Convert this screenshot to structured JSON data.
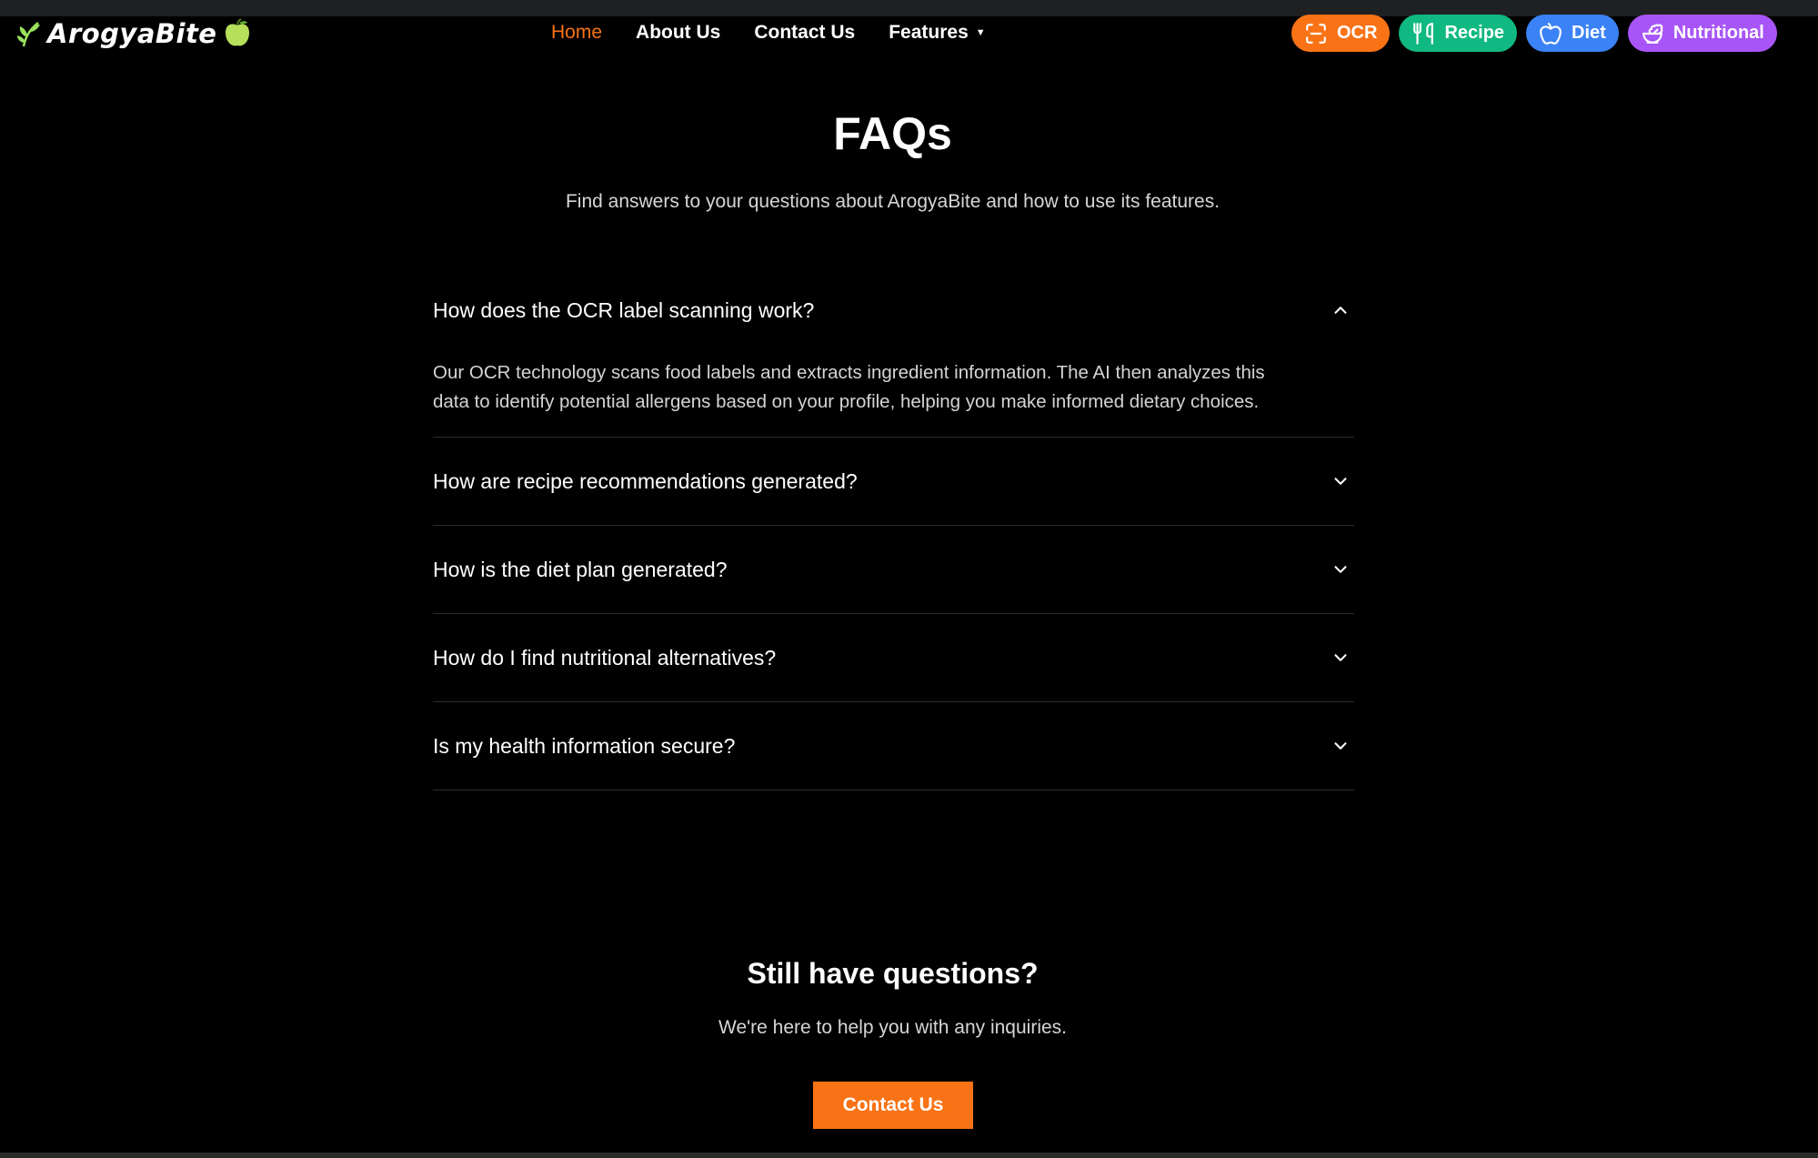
{
  "brand": {
    "name": "ArogyaBite"
  },
  "nav": {
    "links": [
      {
        "label": "Home"
      },
      {
        "label": "About Us"
      },
      {
        "label": "Contact Us"
      }
    ],
    "features_label": "Features",
    "features_caret": "▼"
  },
  "pills": [
    {
      "label": "OCR",
      "icon": "scan-icon",
      "color": "#f97316"
    },
    {
      "label": "Recipe",
      "icon": "utensils-icon",
      "color": "#10b981"
    },
    {
      "label": "Diet",
      "icon": "apple-icon",
      "color": "#3b82f6"
    },
    {
      "label": "Nutritional",
      "icon": "salad-icon",
      "color": "#a855f7"
    }
  ],
  "hero": {
    "title": "FAQs",
    "subtitle": "Find answers to your questions about ArogyaBite and how to use its features."
  },
  "faq": [
    {
      "question": "How does the OCR label scanning work?",
      "answer_line1": "Our OCR technology scans food labels and extracts ingredient information. The AI then analyzes this",
      "answer_line2": "data to identify potential allergens based on your profile, helping you make informed dietary choices."
    },
    {
      "question": "How are recipe recommendations generated?"
    },
    {
      "question": "How is the diet plan generated?"
    },
    {
      "question": "How do I find nutritional alternatives?"
    },
    {
      "question": "Is my health information secure?"
    }
  ],
  "cta": {
    "title": "Still have questions?",
    "subtitle": "We're here to help you with any inquiries.",
    "button_label": "Contact Us"
  },
  "colors": {
    "accent": "#f97316",
    "background": "#000000"
  }
}
